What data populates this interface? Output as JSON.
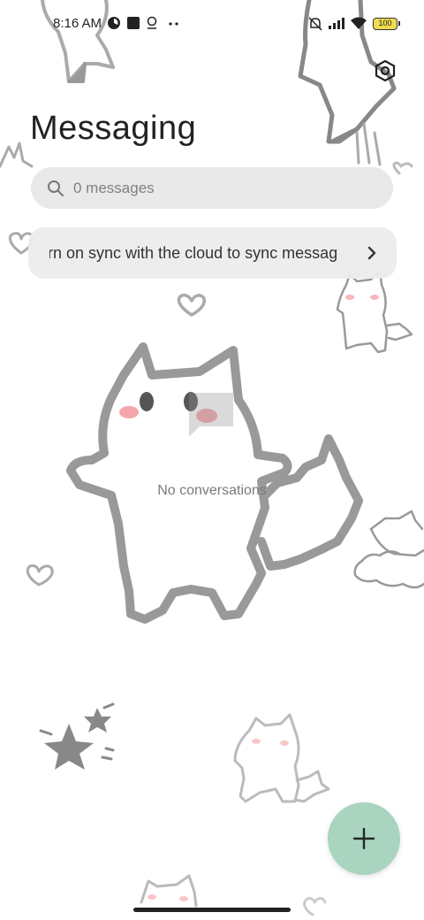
{
  "status_bar": {
    "time": "8:16 AM",
    "battery_level": "100",
    "icons": [
      "speed-icon",
      "square-notification-icon",
      "location-pin-icon",
      "more-dots-icon",
      "mute-vibrate-icon",
      "signal-icon",
      "wifi-icon",
      "battery-icon"
    ]
  },
  "header": {
    "title": "Messaging",
    "settings_icon": "hexagon-settings-icon"
  },
  "search": {
    "placeholder": "0 messages"
  },
  "sync_banner": {
    "text": "urn on sync with the cloud to sync messag"
  },
  "empty_state": {
    "icon": "message-bubble-icon",
    "text": "No conversations"
  },
  "fab": {
    "icon": "plus-icon",
    "color": "#a9d4bf"
  },
  "colors": {
    "accent": "#a9d4bf",
    "search_bg": "#e8e8e8",
    "doodle": "#999999"
  }
}
